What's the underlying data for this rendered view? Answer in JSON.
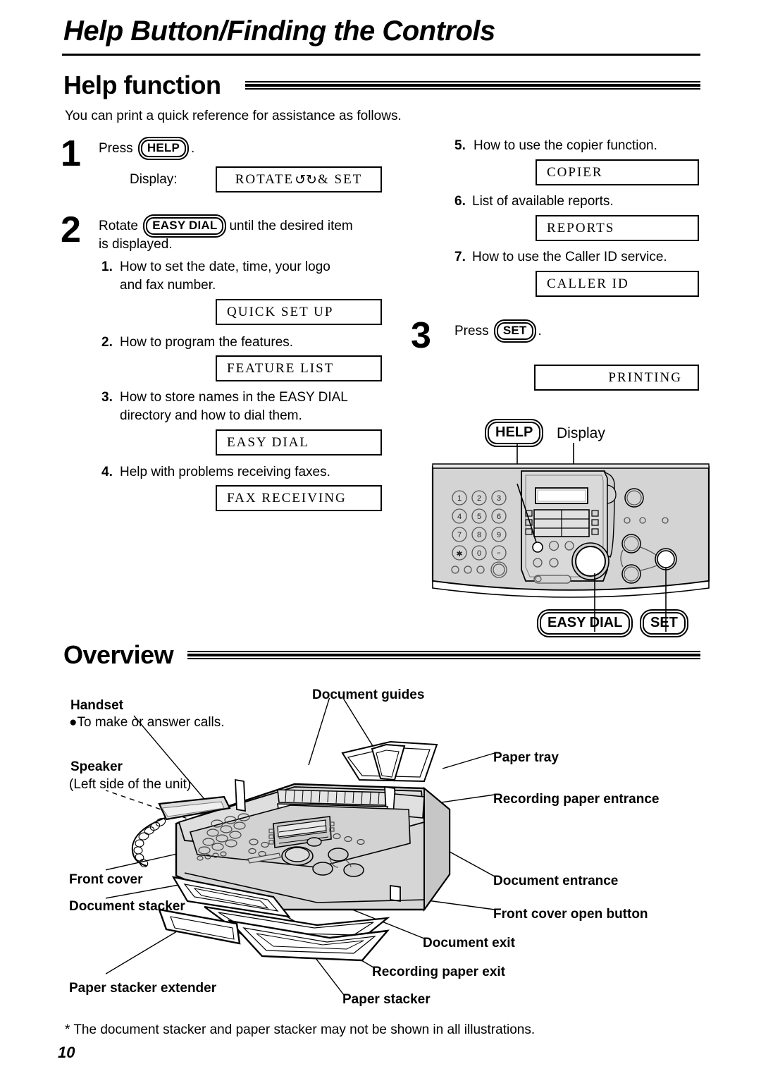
{
  "page": {
    "title": "Help Button/Finding the Controls",
    "number": "10",
    "footnote": "* The document stacker and paper stacker may not be shown in all illustrations."
  },
  "help_section": {
    "heading": "Help function",
    "intro": "You can print a quick reference for assistance as follows.",
    "step1": {
      "number": "1",
      "press_label": "Press",
      "key": "HELP",
      "period": ".",
      "display_label": "Display:",
      "display_value_prefix": "ROTATE",
      "display_glyph": "↺↻",
      "display_value_suffix": "& SET"
    },
    "step2": {
      "number": "2",
      "text_before": "Rotate",
      "key": "EASY DIAL",
      "text_after_line1": "until the desired item",
      "text_after_line2": "is displayed."
    },
    "step3": {
      "number": "3",
      "press_label": "Press",
      "key": "SET",
      "period": ".",
      "display_value": "PRINTING"
    },
    "items": [
      {
        "num": "1.",
        "line1": "How to set the date, time, your logo",
        "line2": "and fax number.",
        "display": "QUICK SET UP"
      },
      {
        "num": "2.",
        "line1": "How to program the features.",
        "line2": "",
        "display": "FEATURE LIST"
      },
      {
        "num": "3.",
        "line1": "How to store names in the EASY DIAL",
        "line2": "directory and how to dial them.",
        "display": "EASY DIAL"
      },
      {
        "num": "4.",
        "line1": "Help with problems receiving faxes.",
        "line2": "",
        "display": "FAX RECEIVING"
      },
      {
        "num": "5.",
        "line1": "How to use the copier function.",
        "line2": "",
        "display": "COPIER"
      },
      {
        "num": "6.",
        "line1": "List of available reports.",
        "line2": "",
        "display": "REPORTS"
      },
      {
        "num": "7.",
        "line1": "How to use the Caller ID service.",
        "line2": "",
        "display": "CALLER ID"
      }
    ],
    "panel_callouts": {
      "help": "HELP",
      "display": "Display",
      "easy_dial": "EASY DIAL",
      "set": "SET"
    },
    "keypad_digits": [
      "1",
      "2",
      "3",
      "4",
      "5",
      "6",
      "7",
      "8",
      "9",
      "∗",
      "0",
      "□"
    ]
  },
  "overview_section": {
    "heading": "Overview",
    "labels": {
      "handset": "Handset",
      "handset_sub": "●To make or answer calls.",
      "speaker": "Speaker",
      "speaker_sub": "(Left side of the unit)",
      "document_guides": "Document guides",
      "paper_tray": "Paper tray",
      "recording_paper_entrance": "Recording paper entrance",
      "document_entrance": "Document entrance",
      "front_cover_open_button": "Front cover open button",
      "document_exit": "Document exit",
      "recording_paper_exit": "Recording paper exit",
      "paper_stacker": "Paper stacker",
      "front_cover": "Front cover",
      "document_stacker": "Document stacker",
      "paper_stacker_extender": "Paper stacker extender"
    }
  },
  "colors": {
    "ink": "#000000",
    "paper": "#ffffff",
    "panel_fill": "#d4d4d4",
    "panel_fill_dark": "#bdbdbd"
  }
}
